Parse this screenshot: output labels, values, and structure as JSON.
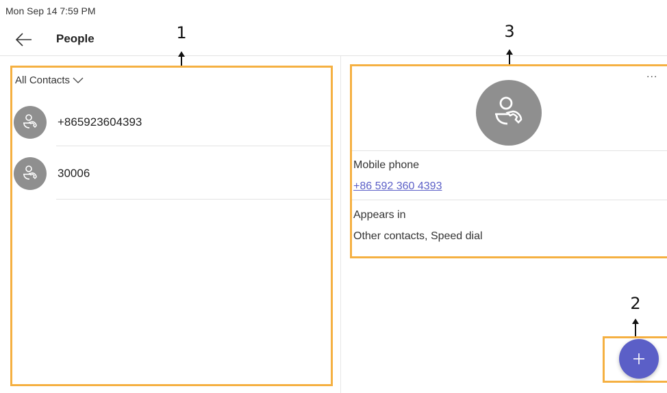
{
  "status_bar": {
    "time": "Mon Sep 14  7:59 PM"
  },
  "header": {
    "title": "People",
    "back_icon": "arrow-left-icon"
  },
  "contacts_panel": {
    "filter_label": "All Contacts",
    "filter_icon": "chevron-down-icon",
    "contacts": [
      {
        "name": "+865923604393",
        "avatar_icon": "contact-phone-icon"
      },
      {
        "name": "30006",
        "avatar_icon": "contact-phone-icon"
      }
    ]
  },
  "detail_panel": {
    "more_label": "...",
    "avatar_icon": "contact-phone-icon",
    "phone_label": "Mobile phone",
    "phone_value": "+86 592 360 4393",
    "appears_label": "Appears in",
    "appears_value": "Other contacts, Speed dial"
  },
  "fab": {
    "icon": "plus-icon"
  },
  "callouts": {
    "one": "1",
    "two": "2",
    "three": "3"
  },
  "colors": {
    "accent": "#5b5fc7",
    "callout": "#f5b041",
    "avatar": "#8f8f8f"
  }
}
